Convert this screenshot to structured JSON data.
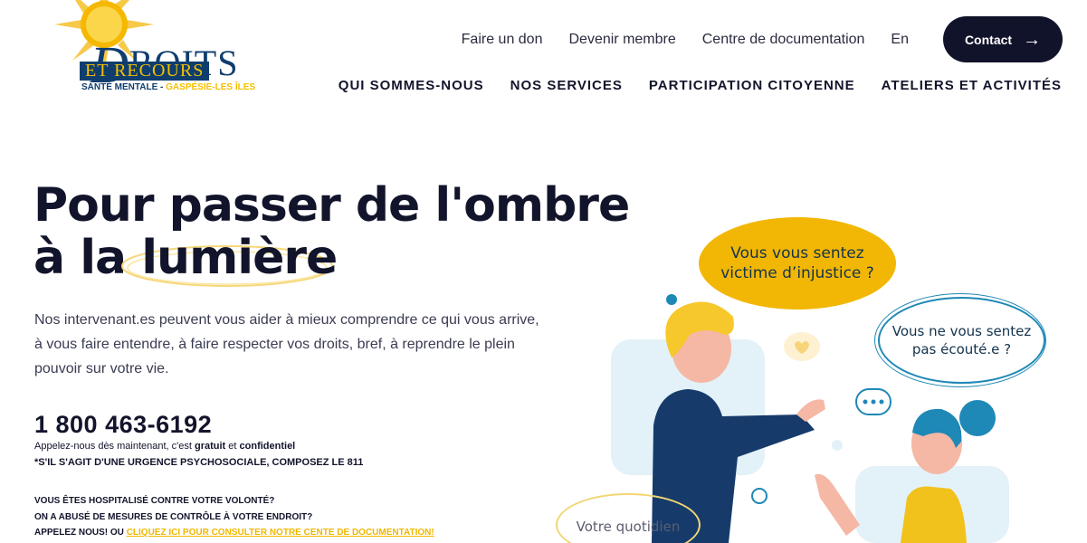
{
  "logo": {
    "main_initial": "D",
    "main_rest": "ROITS",
    "sub": "ET RECOURS",
    "tag_left": "SANTÉ MENTALE - ",
    "tag_right": "GASPÉSIE-LES ÎLES"
  },
  "topnav": {
    "links": [
      "Faire un don",
      "Devenir membre",
      "Centre de documentation",
      "En"
    ],
    "contact_label": "Contact"
  },
  "mainnav": [
    "QUI SOMMES-NOUS",
    "NOS SERVICES",
    "PARTICIPATION CITOYENNE",
    "ATELIERS ET ACTIVITÉS"
  ],
  "hero": {
    "title_line1": "Pour passer de l'ombre",
    "title_line2_start": "à la ",
    "title_highlight": "lumière",
    "intro": "Nos intervenant.es peuvent vous aider à mieux comprendre ce qui vous arrive, à vous faire entendre, à faire respecter vos droits, bref, à reprendre le plein pouvoir sur votre vie.",
    "phone": "1 800 463-6192",
    "phone_note_1": "Appelez-nous dès maintenant, c'est ",
    "phone_note_bold1": "gratuit",
    "phone_note_2": " et ",
    "phone_note_bold2": "confidentiel",
    "urgence": "*S'IL S'AGIT D'UNE URGENCE PSYCHOSOCIALE, COMPOSEZ LE 811",
    "faq_line1": "VOUS ÊTES HOSPITALISÉ CONTRE VOTRE VOLONTÉ?",
    "faq_line2": "ON A ABUSÉ DE MESURES DE CONTRÔLE À VOTRE ENDROIT?",
    "faq_line3_start": "APPELEZ NOUS! OU ",
    "faq_link": "CLIQUEZ ICI POUR CONSULTER NOTRE CENTE DE DOCUMENTATION!"
  },
  "illustration": {
    "bubble_yellow_line1": "Vous vous sentez",
    "bubble_yellow_line2": "victime d’injustice ?",
    "bubble_blue_line1": "Vous ne vous sentez",
    "bubble_blue_line2": "pas écouté.e ?",
    "bubble_bottom": "Votre quotidien"
  },
  "colors": {
    "navy": "#11132a",
    "brand_blue": "#0f3d6e",
    "yellow": "#f2b705",
    "teal": "#1e88b6",
    "light_blue": "#e3f1f8"
  }
}
